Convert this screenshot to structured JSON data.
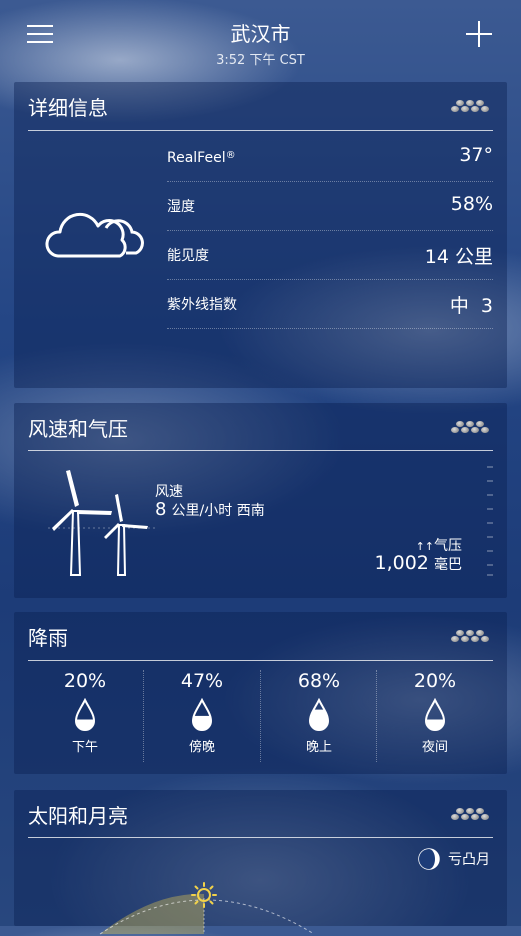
{
  "header": {
    "city": "武汉市",
    "time": "3:52 下午 CST"
  },
  "details": {
    "title": "详细信息",
    "rows": [
      {
        "label": "RealFeel",
        "mark": "®",
        "value": "37°"
      },
      {
        "label": "湿度",
        "value": "58%"
      },
      {
        "label": "能见度",
        "value": "14 公里"
      },
      {
        "label": "紫外线指数",
        "value": "中  3"
      }
    ],
    "condition_icon": "cloud-icon"
  },
  "wind": {
    "title": "风速和气压",
    "wind_label": "风速",
    "wind_value": "8",
    "wind_unit": "公里/小时 西南",
    "pressure_label": "气压",
    "pressure_trend": "↑↑",
    "pressure_value": "1,002",
    "pressure_unit": "毫巴",
    "icon": "wind-turbine-icon"
  },
  "rain": {
    "title": "降雨",
    "items": [
      {
        "pct": "20%",
        "period": "下午",
        "level": 0.2
      },
      {
        "pct": "47%",
        "period": "傍晚",
        "level": 0.47
      },
      {
        "pct": "68%",
        "period": "晚上",
        "level": 0.68
      },
      {
        "pct": "20%",
        "period": "夜间",
        "level": 0.2
      }
    ]
  },
  "sunmoon": {
    "title": "太阳和月亮",
    "moon_phase": "亏凸月",
    "moon_icon": "moon-phase-icon",
    "sun_icon": "sun-icon"
  },
  "colors": {
    "card_bg": "#0a2052",
    "accent_sun": "#f2d24a",
    "text": "#ffffff"
  }
}
